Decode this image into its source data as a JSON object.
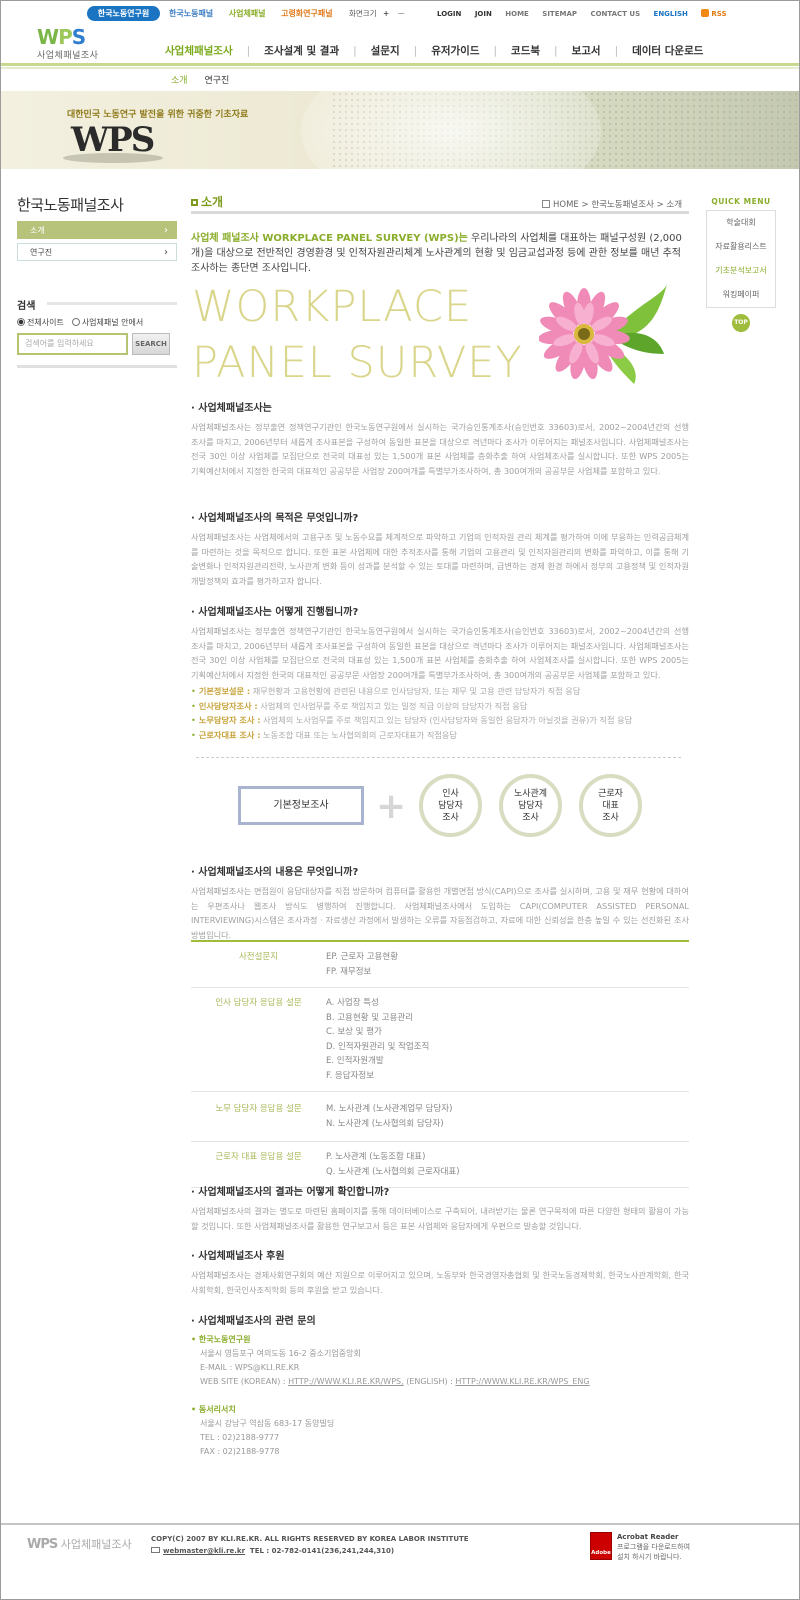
{
  "topbar": {
    "home_pill": "한국노동연구원",
    "links": [
      {
        "label": "한국노동패널",
        "color": "#3f7fc4"
      },
      {
        "label": "사업체패널",
        "color": "#8aad2a"
      },
      {
        "label": "고령화연구패널",
        "color": "#e27b1d"
      }
    ],
    "font_size_label": "화면크기",
    "font_up": "+",
    "font_down": "ㅡ",
    "util": [
      "LOGIN",
      "JOIN",
      "HOME",
      "SITEMAP",
      "CONTACT US"
    ],
    "english": "ENGLISH",
    "rss": "RSS"
  },
  "logo": {
    "w": "W",
    "p": "P",
    "s": "S",
    "sub": "사업체패널조사"
  },
  "gnb": [
    {
      "label": "사업체패널조사",
      "active": true
    },
    {
      "label": "조사설계 및 결과",
      "active": false
    },
    {
      "label": "설문지",
      "active": false
    },
    {
      "label": "유저가이드",
      "active": false
    },
    {
      "label": "코드북",
      "active": false
    },
    {
      "label": "보고서",
      "active": false
    },
    {
      "label": "데이터 다운로드",
      "active": false
    }
  ],
  "subnav": [
    {
      "label": "소개",
      "active": true
    },
    {
      "label": "연구진",
      "active": false
    }
  ],
  "banner": {
    "slogan": "대한민국 노동연구 발전을 위한 귀중한 기초자료",
    "wps": "WPS"
  },
  "sidebar": {
    "title": "한국노동패널조사",
    "items": [
      {
        "label": "소개",
        "active": true
      },
      {
        "label": "연구진",
        "active": false
      }
    ],
    "search": {
      "heading": "검색",
      "radio_all": "전체사이트",
      "radio_panel": "사업체패널 안에서",
      "placeholder": "검색어를 입력하세요",
      "button": "SEARCH"
    }
  },
  "content": {
    "title": "소개",
    "breadcrumb": {
      "home": "HOME",
      "parent": "한국노동패널조사",
      "current": "소개"
    },
    "intro_highlight": "사업체 패널조사 WORKPLACE PANEL SURVEY (WPS)는",
    "intro_rest": " 우리나라의 사업체를 대표하는 패널구성원 (2,000개)을 대상으로 전반적인 경영환경 및 인적자원관리체계 노사관계의 현황 및 임금교섭과정 등에 관한 정보를 매년 추적조사하는 종단면 조사입니다.",
    "big_line1": "WORKPLACE",
    "big_line2": "PANEL SURVEY",
    "sections": {
      "s1": {
        "heading": "· 사업체패널조사는",
        "body": "사업체패널조사는 정부출연 정책연구기관인 한국노동연구원에서 실시하는 국가승인통계조사(승인번호 33603)로서, 2002~2004년간의 선행 조사를 마치고, 2006년부터 새롭게 조사표본을 구성하여 동일한 표본을 대상으로 격년마다 조사가 이루어지는 패널조사입니다. 사업체패널조사는 전국 30인 이상 사업체를 모집단으로 전국의 대표성 있는 1,500개 표본 사업체를 층화추출 하여 사업체조사를 실시합니다. 또한 WPS 2005는 기획예산처에서 지정한 한국의 대표적인 공공부문 사업장 200여개를 특별부가조사하여, 총 300여개의 공공부문 사업체를 포함하고 있다."
      },
      "s2": {
        "heading": "· 사업체패널조사의 목적은 무엇입니까?",
        "body": "사업체패널조사는 사업체에서의 고용구조 및 노동수요를 체계적으로 파악하고 기업의 인적자원 관리 체계를 평가하여 이에 부응하는 인력공급체계를 마련하는 것을 목적으로 합니다. 또한 표본 사업체에 대한 추적조사를 통해 기업의 고용관리 및 인적자원관리의 변화를 파악하고, 이를 통해 기술변화나 인적자원관리전략, 노사관계 변화 등이 성과를 분석할 수 있는 토대를 마련하며, 급변하는 경제 환경 하에서 정부의 고용정책 및 인적자원개발정책의 효과를 평가하고자 합니다."
      },
      "s3": {
        "heading": "· 사업체패널조사는 어떻게 진행됩니까?",
        "body": "사업체패널조사는 정부출연 정책연구기관인 한국노동연구원에서 실시하는 국가승인통계조사(승인번호 33603)로서, 2002~2004년간의 선행 조사를 마치고, 2006년부터 새롭게 조사표본을 구성하여 동일한 표본을 대상으로 격년마다 조사가 이루어지는 패널조사입니다. 사업체패널조사는 전국 30인 이상 사업체를 모집단으로 전국의 대표성 있는 1,500개 표본 사업체를 층화추출 하여 사업체조사를 실시합니다. 또한 WPS 2005는 기획예산처에서 지정한 한국의 대표적인 공공부문 사업장 200여개를 특별부가조사하여, 총 300여개의 공공부문 사업체를 포함하고 있다.",
        "bullets": [
          {
            "label": "기본정보설문 :",
            "text": " 재무현황과 고용현황에 관련된 내용으로 인사담당자, 또는 재무 및 고용 관련 담당자가 직접 응답"
          },
          {
            "label": "인사담당자조사 :",
            "text": " 사업체의 인사업무를 주로 책임지고 있는 일정 직급 이상의 담당자가 직접 응답"
          },
          {
            "label": "노무담당자 조사 :",
            "text": " 사업체의 노사업무를 주로 책임지고 있는 담당자 (인사담당자와 동일한 응답자가 아닐것을 권유)가 직접 응답"
          },
          {
            "label": "근로자대표 조사 :",
            "text": " 노동조합 대표 또는 노사협의회의 근로자대표가 직접응답"
          }
        ]
      },
      "diagram": {
        "basic": "기본정보조사",
        "c1": [
          "인사",
          "담당자",
          "조사"
        ],
        "c2": [
          "노사관계",
          "담당자",
          "조사"
        ],
        "c3": [
          "근로자",
          "대표",
          "조사"
        ]
      },
      "s4": {
        "heading": "· 사업체패널조사의 내용은 무엇입니까?",
        "body": "사업체패널조사는 면접원이 응답대상자를 직접 방문하여 컴퓨터를 활용한 개별면접 방식(CAPI)으로 조사를 실시하며, 고용 및 재무 현황에 대하여는 우편조사나 웹조사 방식도 병행하여 진행합니다. 사업체패널조사에서 도입하는 CAPI(COMPUTER ASSISTED PERSONAL INTERVIEWING)시스템은 조사과정 · 자료생산 과정에서 발생하는 오류를 자동점검하고, 자료에 대한 신뢰성을 한층 높일 수 있는 선진화된 조사방법입니다."
      },
      "table": [
        {
          "key": "사전설문지",
          "values": [
            "EP. 근로자 고용현황",
            "FP. 재무정보"
          ]
        },
        {
          "key": "인사 담당자 응답용 설문",
          "values": [
            "A. 사업장 특성",
            "B. 고용현황 및 고용관리",
            "C. 보상 및 평가",
            "D. 인적자원관리 및 작업조직",
            "E. 인적자원개발",
            "F. 응답자정보"
          ]
        },
        {
          "key": "노무 담당자 응답용 설문",
          "values": [
            "M. 노사관계 (노사관계업무 담당자)",
            "N. 노사관계 (노사협의회 담당자)"
          ]
        },
        {
          "key": "근로자 대표 응답용 설문",
          "values": [
            "P. 노사관계 (노동조합 대표)",
            "Q. 노사관계 (노사협의회 근로자대표)"
          ]
        }
      ],
      "s5": {
        "heading": "· 사업체패널조사의 결과는 어떻게 확인합니까?",
        "body": "사업체패널조사의 결과는 별도로 마련된 홈페이지를 통해 데이터베이스로 구축되어, 내려받기는 물론 연구목적에 따른 다양한 형태의 활용이 가능할 것입니다. 또한 사업체패널조사를 활용한 연구보고서 등은 표본 사업체와 응답자에게 우편으로 발송할 것입니다."
      },
      "s6": {
        "heading": "· 사업체패널조사 후원",
        "body": "사업체패널조사는 경제사회연구회의 예산 지원으로 이루어지고 있으며, 노동부와 한국경영자총협회 및 한국노동경제학회, 한국노사관계학회, 한국사회학회, 한국인사조직학회 등의 후원을 받고 있습니다."
      },
      "s7": {
        "heading": "· 사업체패널조사의 관련 문의",
        "org1": "한국노동연구원",
        "org1_addr": "서울시 영등포구 여의도동 16-2 중소기업중앙회",
        "org1_email": "E-MAIL : WPS@KLI.RE.KR",
        "org1_web_prefix": "WEB SITE (KOREAN) : ",
        "org1_web_kr": "HTTP://WWW.KLI.RE.KR/WPS,",
        "org1_web_mid": " (ENGLISH) : ",
        "org1_web_en": "HTTP://WWW.KLI.RE.KR/WPS_ENG",
        "org2": "동서리서치",
        "org2_addr": "서울시 강남구 역삼동 683-17 동양빌딩",
        "org2_tel": "TEL : 02)2188-9777",
        "org2_fax": "FAX : 02)2188-9778"
      }
    }
  },
  "quick_menu": {
    "title": "QUICK MENU",
    "items": [
      {
        "label": "학술대회",
        "active": false
      },
      {
        "label": "자료활용리스트",
        "active": false
      },
      {
        "label": "기초분석보고서",
        "active": true
      },
      {
        "label": "워킹페이퍼",
        "active": false
      }
    ],
    "top": "TOP"
  },
  "footer": {
    "logo": "WPS",
    "logo_sub": "사업체패널조사",
    "copyright": "COPY(C) 2007 BY KLI.RE.KR. ALL RIGHTS RESERVED BY KOREA LABOR INSTITUTE",
    "email": "webmaster@kli.re.kr",
    "tel": "TEL : 02-782-0141(236,241,244,310)",
    "adobe_badge": "Adobe",
    "adobe_title": "Acrobat Reader",
    "adobe_line1": "프로그램을 다운로드하여",
    "adobe_line2": "설치 하시기 바랍니다."
  },
  "colors": {
    "accent": "#8aad2a",
    "brand_blue": "#1a74c2",
    "rule_green": "#c9d88f"
  }
}
